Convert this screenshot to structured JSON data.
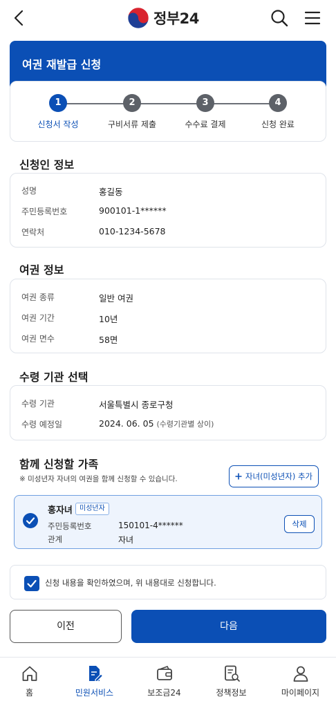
{
  "header": {
    "app_name": "정부24",
    "icons": [
      "back-arrow-icon",
      "government-emblem-icon",
      "search-icon",
      "hamburger-menu-icon"
    ]
  },
  "page": {
    "title": "여권 재발급 신청"
  },
  "steps": [
    {
      "number": "1",
      "label": "신청서 작성",
      "active": true
    },
    {
      "number": "2",
      "label": "구비서류 제출",
      "active": false
    },
    {
      "number": "3",
      "label": "수수료 결제",
      "active": false
    },
    {
      "number": "4",
      "label": "신청 완료",
      "active": false
    }
  ],
  "applicant": {
    "title": "신청인 정보",
    "rows": [
      {
        "key": "성명",
        "value": "홍길동"
      },
      {
        "key": "주민등록번호",
        "value": "900101-1******"
      },
      {
        "key": "연락처",
        "value": "010-1234-5678"
      }
    ]
  },
  "passport": {
    "title": "여권 정보",
    "rows": [
      {
        "key": "여권 종류",
        "value": "일반 여권"
      },
      {
        "key": "여권 기간",
        "value": "10년"
      },
      {
        "key": "여권 면수",
        "value": "58면"
      }
    ]
  },
  "agency": {
    "title": "수령 기관 선택",
    "rows": [
      {
        "key": "수령 기관",
        "value": "서울특별시 종로구청"
      },
      {
        "key": "수령 예정일",
        "value": "2024. 06. 05",
        "note": "(수령기관별 상이)"
      }
    ]
  },
  "family": {
    "title": "함께 신청할 가족",
    "note": "※ 미성년자 자녀의 여권을 함께 신청할 수 있습니다.",
    "add_button": "자녀(미성년자) 추가",
    "member": {
      "name": "홍자녀",
      "badge": "미성년자",
      "id_label": "주민등록번호",
      "id_value": "150101-4******",
      "relation_label": "관계",
      "relation_value": "자녀",
      "delete_button": "삭제",
      "checked": true
    }
  },
  "agreement": {
    "text": "신청 내용을 확인하였으며, 위 내용대로 신청합니다.",
    "checked": true
  },
  "actions": {
    "prev": "이전",
    "next": "다음"
  },
  "tabbar": [
    {
      "label": "홈",
      "icon": "home-icon",
      "active": false
    },
    {
      "label": "민원서비스",
      "icon": "document-edit-icon",
      "active": true
    },
    {
      "label": "보조금24",
      "icon": "wallet-icon",
      "active": false
    },
    {
      "label": "정책정보",
      "icon": "policy-document-icon",
      "active": false
    },
    {
      "label": "마이페이지",
      "icon": "person-icon",
      "active": false
    }
  ],
  "colors": {
    "primary": "#0b4fb5",
    "step_inactive": "#5d6168",
    "border": "#dfe3ea",
    "selected_bg": "#eef4fd"
  }
}
